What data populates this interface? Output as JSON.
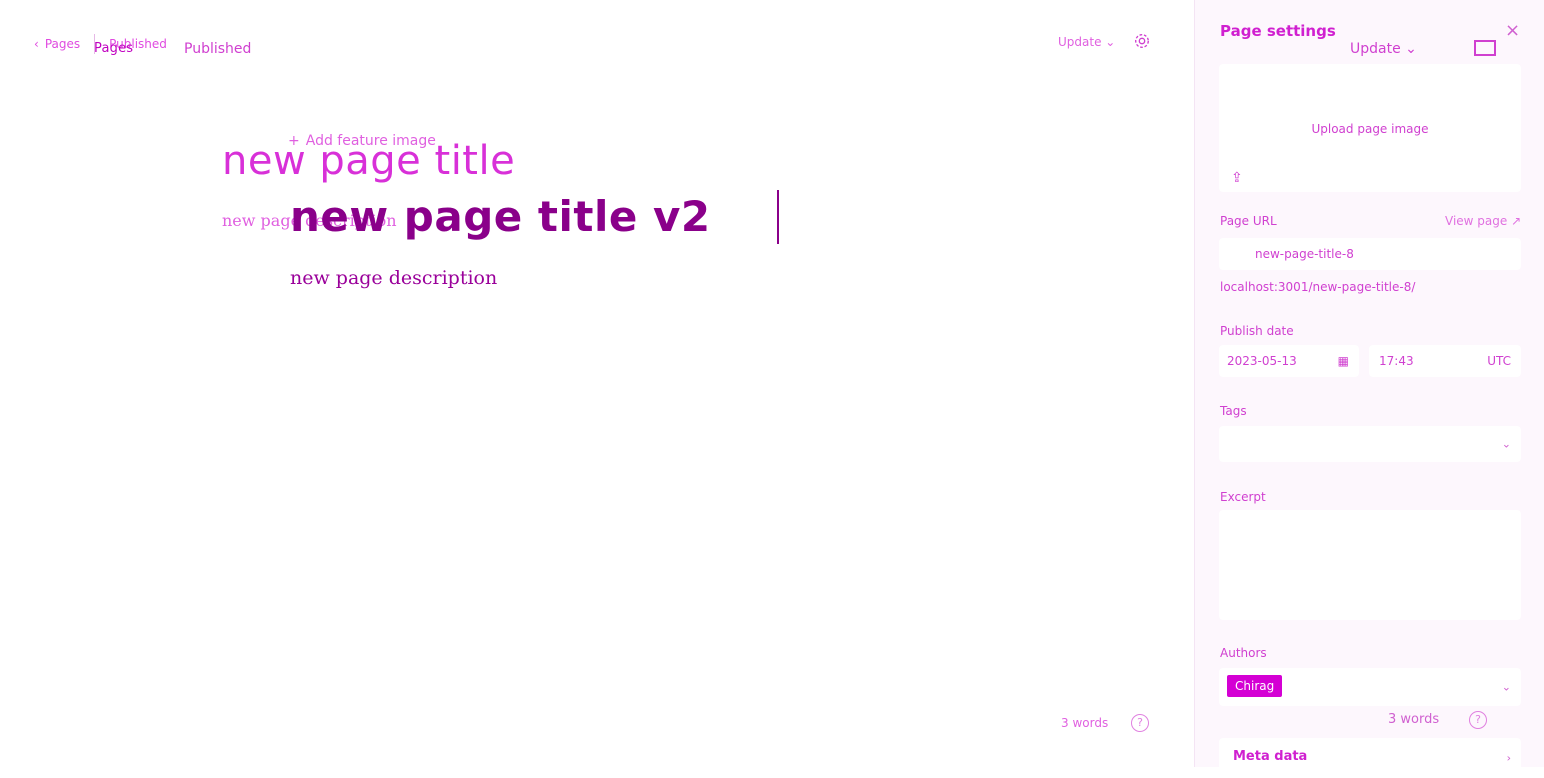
{
  "header": {
    "breadcrumb_pages": "Pages",
    "breadcrumb_status": "Published",
    "ghost_pages": "Pages",
    "ghost_status": "Published",
    "update_label": "Update",
    "update_chevron": "⌄"
  },
  "editor": {
    "add_feature_label": "Add feature image",
    "title_ghost": "new page title",
    "subtitle_ghost": "new page description",
    "title": "new page title v2",
    "description": "new page description",
    "word_count": "3 words",
    "help_glyph": "?"
  },
  "panel": {
    "title": "Page settings",
    "close_glyph": "×",
    "update_label": "Update",
    "upload_label": "Upload page image",
    "upload_glyph": "⇪",
    "url_label": "Page URL",
    "view_page_label": "View page ↗",
    "url_value": "new-page-title-8",
    "url_hint": "localhost:3001/new-page-title-8/",
    "publish_date_label": "Publish date",
    "date_value": "2023-05-13",
    "time_value": "17:43",
    "timezone": "UTC",
    "tags_label": "Tags",
    "excerpt_label": "Excerpt",
    "authors_label": "Authors",
    "author_chip": "Chirag",
    "word_count": "3 words",
    "help_glyph": "?",
    "meta_label": "Meta data",
    "meta_chevron": "›",
    "select_chevron": "⌄"
  },
  "colors": {
    "accent": "#d400d4",
    "dark_accent": "#8a008a",
    "panel_bg": "#fdf7fd"
  }
}
